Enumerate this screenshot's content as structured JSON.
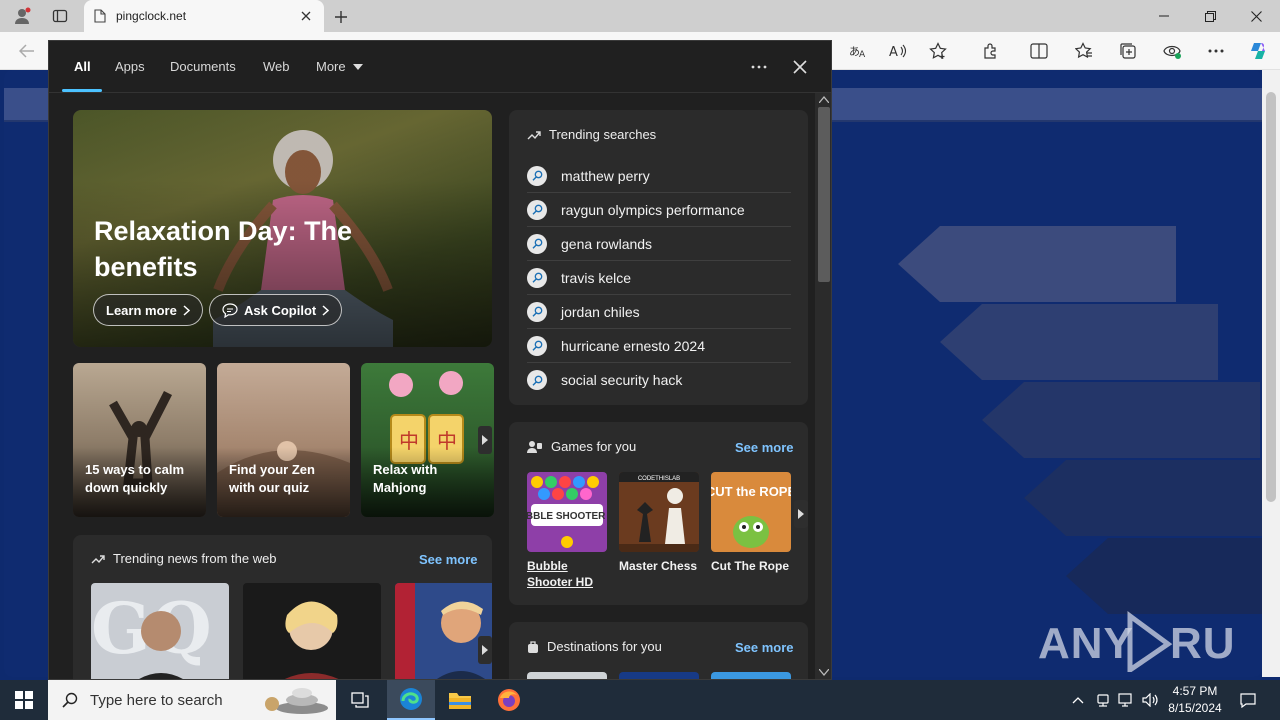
{
  "browser": {
    "tab_title": "pingclock.net"
  },
  "panel": {
    "tabs": [
      "All",
      "Apps",
      "Documents",
      "Web",
      "More"
    ],
    "hero": {
      "title": "Relaxation Day: The benefits",
      "learn_more": "Learn more",
      "ask_copilot": "Ask Copilot"
    },
    "cards": [
      {
        "label": "15 ways to calm down quickly"
      },
      {
        "label": "Find your Zen with our quiz"
      },
      {
        "label": "Relax with Mahjong"
      }
    ],
    "trending_news": {
      "title": "Trending news from the web",
      "see_more": "See more"
    },
    "trending_searches": {
      "title": "Trending searches",
      "items": [
        "matthew perry",
        "raygun olympics performance",
        "gena rowlands",
        "travis kelce",
        "jordan chiles",
        "hurricane ernesto 2024",
        "social security hack"
      ]
    },
    "games": {
      "title": "Games for you",
      "see_more": "See more",
      "items": [
        {
          "label": "Bubble Shooter HD",
          "thumb_text": "BUBBLE SHOOTER HD"
        },
        {
          "label": "Master Chess",
          "thumb_text": "CODETHISLAB"
        },
        {
          "label": "Cut The Rope",
          "thumb_text": "CUT the ROPE"
        }
      ]
    },
    "destinations": {
      "title": "Destinations for you",
      "see_more": "See more"
    }
  },
  "watermark": "ANY RUN",
  "taskbar": {
    "search_placeholder": "Type here to search",
    "time": "4:57 PM",
    "date": "8/15/2024"
  },
  "colors": {
    "accent": "#4cc2ff",
    "link": "#7fc4ff",
    "panel_bg": "#202020",
    "card_bg": "#2b2b2b",
    "page_bg": "#0f2b70"
  }
}
